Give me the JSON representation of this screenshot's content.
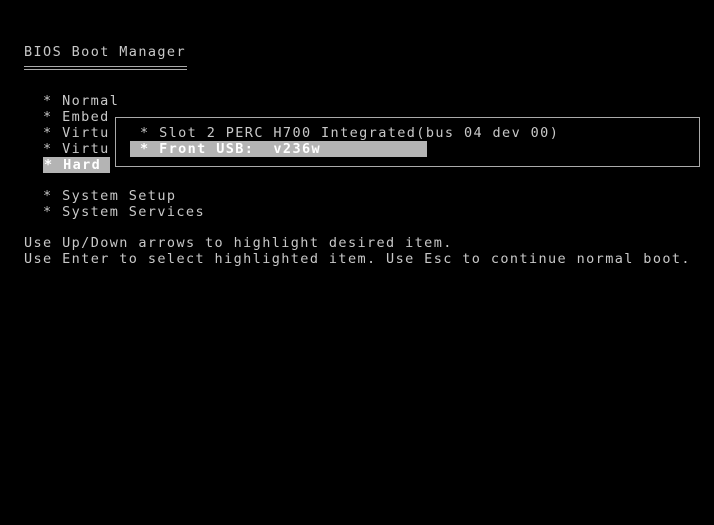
{
  "title": "BIOS Boot Manager",
  "menu": [
    {
      "label": "Normal",
      "selected": false
    },
    {
      "label": "Embed",
      "selected": false
    },
    {
      "label": "Virtu",
      "selected": false
    },
    {
      "label": "Virtu",
      "selected": false
    },
    {
      "label": "Hard",
      "selected": true
    }
  ],
  "menu2": [
    {
      "label": "System Setup"
    },
    {
      "label": "System Services"
    }
  ],
  "bullet": "*",
  "popup": {
    "items": [
      {
        "label": "Slot 2 PERC H700 Integrated(bus 04 dev 00)",
        "selected": false
      },
      {
        "label": "Front USB:  v236w",
        "selected": true
      }
    ]
  },
  "help": [
    "Use Up/Down arrows to highlight desired item.",
    "Use Enter to select highlighted item. Use Esc to continue normal boot."
  ]
}
